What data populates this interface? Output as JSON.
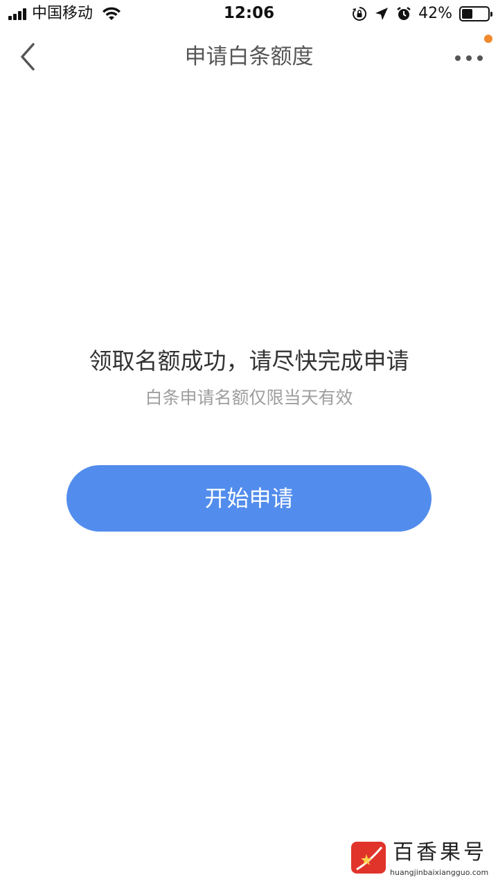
{
  "status_bar": {
    "carrier": "中国移动",
    "time": "12:06",
    "battery_percent": "42%",
    "battery_level": 0.42
  },
  "nav": {
    "title": "申请白条额度",
    "back_icon": "chevron-left-icon",
    "more_icon": "more-dots-icon",
    "notification_color": "#f08a2c"
  },
  "main": {
    "headline": "领取名额成功，请尽快完成申请",
    "subline": "白条申请名额仅限当天有效",
    "apply_button_label": "开始申请",
    "accent_color": "#528ded"
  },
  "watermark": {
    "brand": "百香果号",
    "url": "huangjinbaixiangguo.com"
  }
}
